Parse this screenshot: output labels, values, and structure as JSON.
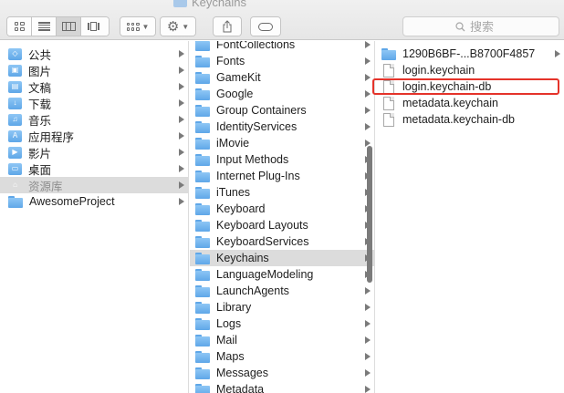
{
  "window": {
    "title": "Keychains"
  },
  "search": {
    "placeholder": "搜索"
  },
  "column1": {
    "items": [
      {
        "label": "公共",
        "icon": "public-folder-icon",
        "glyph": "◇",
        "has_arrow": true
      },
      {
        "label": "图片",
        "icon": "pictures-folder-icon",
        "glyph": "▣",
        "has_arrow": true
      },
      {
        "label": "文稿",
        "icon": "documents-folder-icon",
        "glyph": "▤",
        "has_arrow": true
      },
      {
        "label": "下载",
        "icon": "downloads-folder-icon",
        "glyph": "↓",
        "has_arrow": true
      },
      {
        "label": "音乐",
        "icon": "music-folder-icon",
        "glyph": "♫",
        "has_arrow": true
      },
      {
        "label": "应用程序",
        "icon": "applications-folder-icon",
        "glyph": "A",
        "has_arrow": true
      },
      {
        "label": "影片",
        "icon": "movies-folder-icon",
        "glyph": "▶",
        "has_arrow": true
      },
      {
        "label": "桌面",
        "icon": "desktop-folder-icon",
        "glyph": "▭",
        "has_arrow": true
      },
      {
        "label": "资源库",
        "icon": "library-folder-icon",
        "glyph": "⌂",
        "has_arrow": true,
        "selected": true
      },
      {
        "label": "AwesomeProject",
        "icon": "folder-icon",
        "has_arrow": true
      }
    ]
  },
  "column2": {
    "items": [
      {
        "label": "FontCollections"
      },
      {
        "label": "Fonts"
      },
      {
        "label": "GameKit"
      },
      {
        "label": "Google"
      },
      {
        "label": "Group Containers"
      },
      {
        "label": "IdentityServices"
      },
      {
        "label": "iMovie"
      },
      {
        "label": "Input Methods"
      },
      {
        "label": "Internet Plug-Ins"
      },
      {
        "label": "iTunes"
      },
      {
        "label": "Keyboard"
      },
      {
        "label": "Keyboard Layouts"
      },
      {
        "label": "KeyboardServices"
      },
      {
        "label": "Keychains",
        "selected": true
      },
      {
        "label": "LanguageModeling"
      },
      {
        "label": "LaunchAgents"
      },
      {
        "label": "Library"
      },
      {
        "label": "Logs"
      },
      {
        "label": "Mail"
      },
      {
        "label": "Maps"
      },
      {
        "label": "Messages"
      },
      {
        "label": "Metadata"
      }
    ]
  },
  "column3": {
    "items": [
      {
        "label": "1290B6BF-...B8700F4857",
        "type": "folder",
        "has_arrow": true
      },
      {
        "label": "login.keychain",
        "type": "file"
      },
      {
        "label": "login.keychain-db",
        "type": "file",
        "highlighted": true
      },
      {
        "label": "metadata.keychain",
        "type": "file"
      },
      {
        "label": "metadata.keychain-db",
        "type": "file"
      }
    ]
  },
  "colors": {
    "highlight": "#e5332a",
    "folder": "#5fa7e8",
    "selection": "#dcdcdc"
  }
}
